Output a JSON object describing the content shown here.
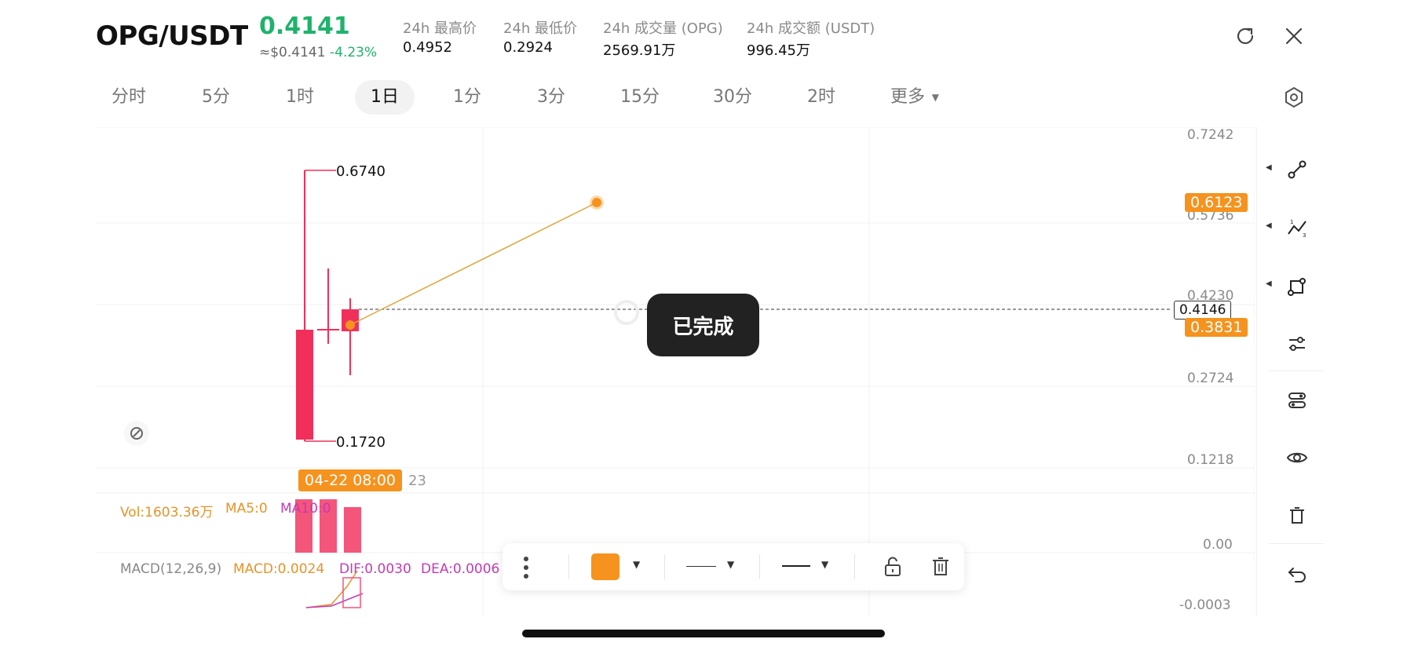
{
  "header": {
    "pair": "OPG/USDT",
    "price": "0.4141",
    "approx_price": "≈$0.4141",
    "change": "-4.23%",
    "stats": [
      {
        "label": "24h 最高价",
        "value": "0.4952"
      },
      {
        "label": "24h 最低价",
        "value": "0.2924"
      },
      {
        "label": "24h 成交量 (OPG)",
        "value": "2569.91万"
      },
      {
        "label": "24h 成交额 (USDT)",
        "value": "996.45万"
      }
    ]
  },
  "tabs": [
    "分时",
    "5分",
    "1时",
    "1日",
    "1分",
    "3分",
    "15分",
    "30分",
    "2时",
    "更多"
  ],
  "active_tab": "1日",
  "chart": {
    "y_axis_labels": [
      "0.7242",
      "0.5736",
      "0.4230",
      "0.2724",
      "0.1218"
    ],
    "high_label": "0.6740",
    "low_label": "0.1720",
    "current_price_tag": "0.4146",
    "line_tag_top": "0.6123",
    "line_tag_bottom": "0.3831",
    "time_tag": "04-22 08:00",
    "time_tag_suffix": "23",
    "vol_text": "Vol:1603.36万",
    "ma5_text": "MA5:0",
    "ma10_text": "MA10:0",
    "vol_axis_label": "0.00",
    "macd_title": "MACD(12,26,9)",
    "macd_value": "MACD:0.0024",
    "dif_value": "DIF:0.0030",
    "dea_value": "DEA:0.0006",
    "macd_axis_label": "-0.0003",
    "colors": {
      "down": "#f0305a",
      "up": "#20b26c",
      "accent": "#f5931e",
      "vol": "#f4557a",
      "macd": "#e6932a",
      "dea": "#c23bb7"
    }
  },
  "toast": "已完成",
  "right_toolbar": [
    "trendline-tool-icon",
    "fib-tool-icon",
    "shape-tool-icon",
    "indicator-settings-icon",
    "layers-icon",
    "visibility-icon",
    "delete-all-icon",
    "undo-icon"
  ],
  "bottom_toolbar": {
    "color": "#f5931e"
  }
}
